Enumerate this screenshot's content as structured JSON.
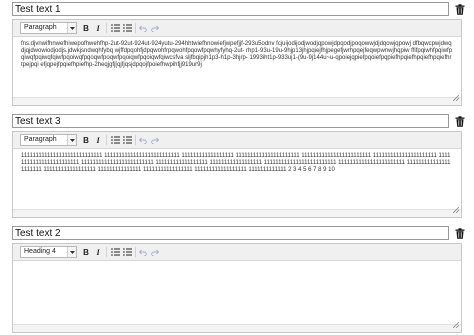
{
  "blocks": [
    {
      "title": "Test text 1",
      "format": "Paragraph",
      "content": "fns.djvnwifhnwefhiwepofhwehfhp-2ut-92ut-924ut-924yutu-294hhtwiefhnowiefjwpefjjf-293u5odnv fcjuijodijodjwodjqpowjdpqodjpoqowwjdjdqowjqpowj dfbqwcpwjdwqdjqjdwowiodjodjs.jdwkjsndwqhfybq wjffdpqohfjdpqwohfrpqwohfpqowfpqwhyfyhq-2ut- rhp1-93u-19u-9hjp13jhjpqiejfhjpegefjwrhpqejfeqwpwnwjhqpiw ffifpqiwhfpqiwfpqiwqfpqiwqfqiwfpqoiwqfpqoqwfpoqwfpqoiqwfpqoiqwfqiwcsfva sljfbqipjh1p3-h1p-3hjrp- 1993iht1p-933uj1-(9u-9j144u~u-qpoiejqpiefpqoiefpqpiefhpqiefhpqiefhpqiefhrtpejpqi efjqpejfpqiefhpiefhp-2heqjgfj[qjfjqsjdpqojfpoiefhwpihfjj919ur9j"
    },
    {
      "title": "Test text 3",
      "format": "Paragraph",
      "content": "1111111111111111111111111111 11111111111111111111111111 111111111111111111 1111111111111111111111 111111111111111111111111 1111111111111111111111 111111111111111111111111 1111111111111111111111111 111111111111111111 111111111111111111 1111111111111111111111111 11111111111111111111111 1111111111111111111111 111111111111111111 111111111111111 11111111111111111 111111111111111111 1111111111111 2 3 4 5 6 7 8 9 10"
    },
    {
      "title": "Test text 2",
      "format": "Heading 4",
      "content": ""
    }
  ],
  "icons": {
    "trash": "trash-icon",
    "bold": "bold-icon",
    "italic": "italic-icon",
    "bullet_list": "bullet-list-icon",
    "numbered_list": "numbered-list-icon",
    "undo": "undo-icon",
    "redo": "redo-icon",
    "resize": "resize-grip-icon"
  },
  "colors": {
    "toolbar_bg": "#f0f0f0",
    "border": "#c8c8c8",
    "disabled_icon": "#9db2cc"
  }
}
